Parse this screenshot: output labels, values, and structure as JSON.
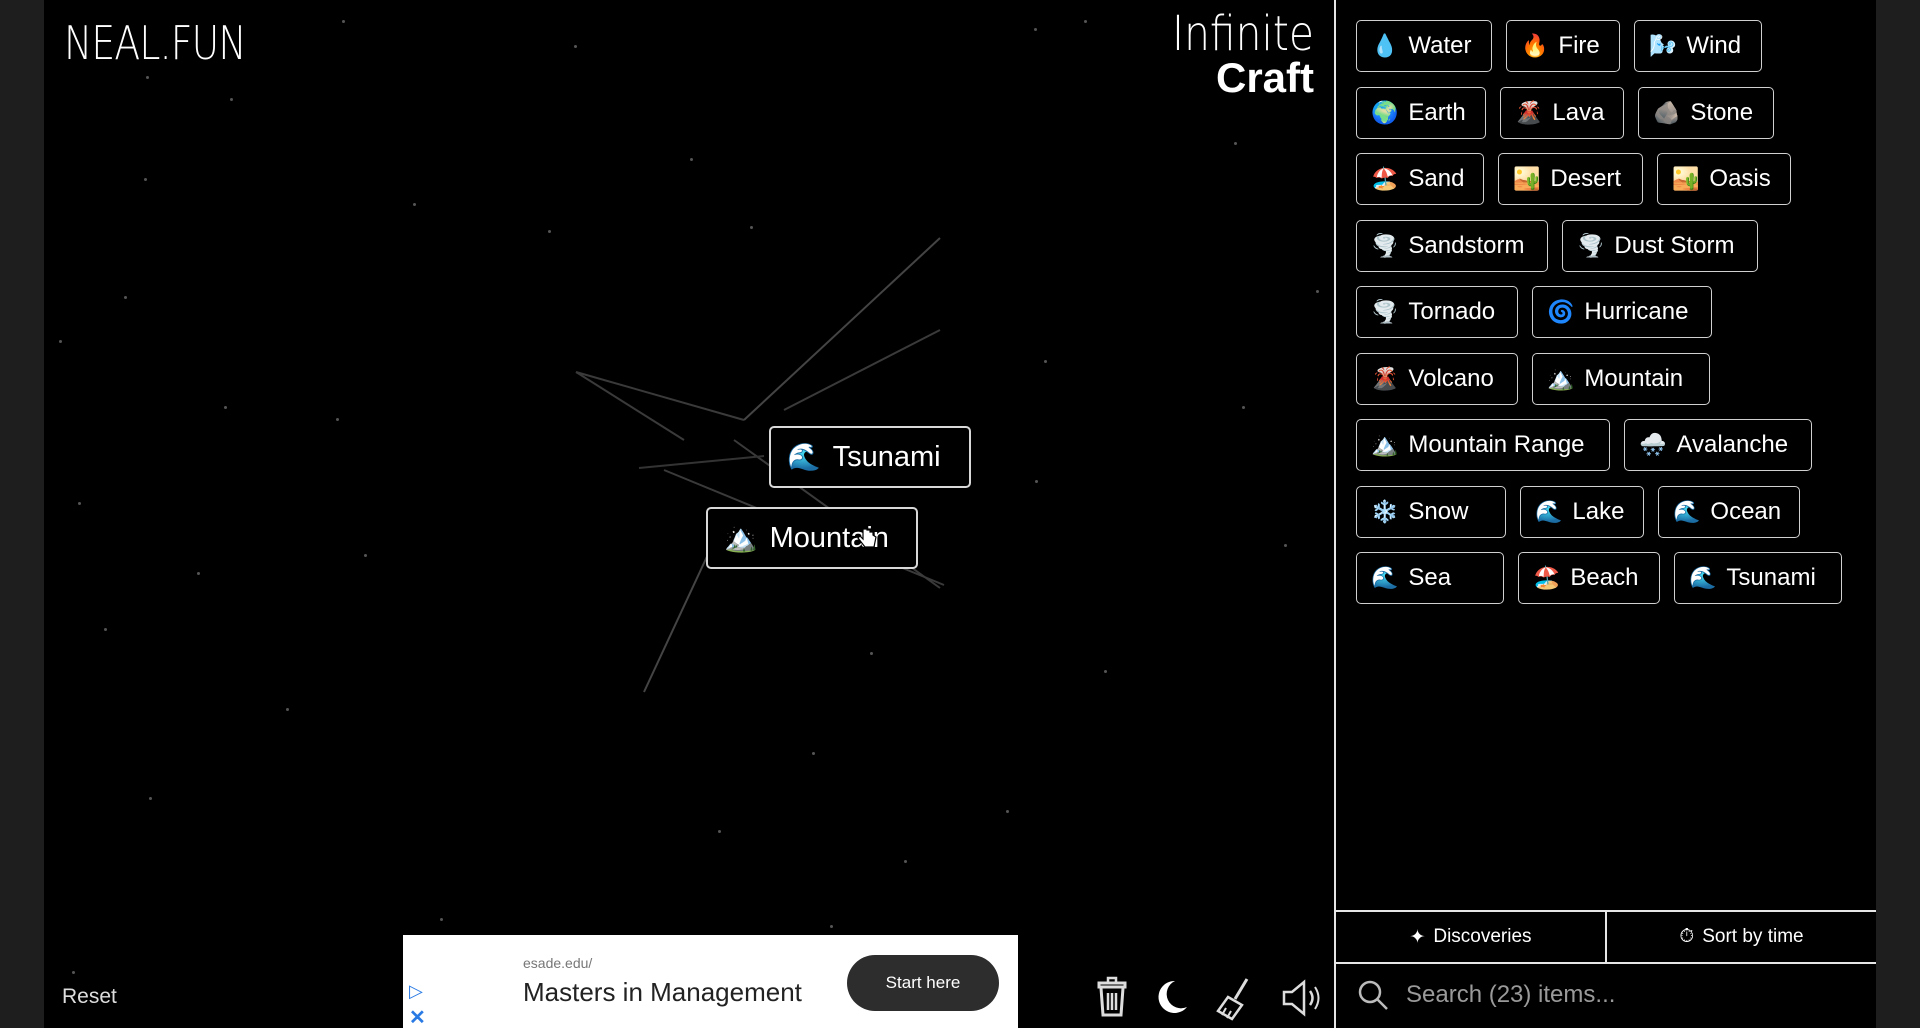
{
  "brand": {
    "left": "NEAL.FUN",
    "right_line1": "Infinite",
    "right_line2": "Craft"
  },
  "canvas": {
    "chips": [
      {
        "emoji": "🌊",
        "label": "Tsunami"
      },
      {
        "emoji": "🏔️",
        "label": "Mountain"
      }
    ],
    "reset_label": "Reset"
  },
  "ad": {
    "url": "esade.edu/",
    "title": "Masters in Management",
    "cta": "Start here",
    "play_glyph": "▷",
    "close_glyph": "✕"
  },
  "toolbar": {
    "icons": [
      "trash-icon",
      "moon-icon",
      "broom-icon",
      "speaker-icon"
    ]
  },
  "sidebar": {
    "items": [
      {
        "emoji": "💧",
        "label": "Water"
      },
      {
        "emoji": "🔥",
        "label": "Fire"
      },
      {
        "emoji": "🌬️",
        "label": "Wind"
      },
      {
        "emoji": "🌍",
        "label": "Earth"
      },
      {
        "emoji": "🌋",
        "label": "Lava"
      },
      {
        "emoji": "🪨",
        "label": "Stone"
      },
      {
        "emoji": "🏖️",
        "label": "Sand"
      },
      {
        "emoji": "🏜️",
        "label": "Desert"
      },
      {
        "emoji": "🏜️",
        "label": "Oasis"
      },
      {
        "emoji": "🌪️",
        "label": "Sandstorm"
      },
      {
        "emoji": "🌪️",
        "label": "Dust Storm"
      },
      {
        "emoji": "🌪️",
        "label": "Tornado"
      },
      {
        "emoji": "🌀",
        "label": "Hurricane"
      },
      {
        "emoji": "🌋",
        "label": "Volcano"
      },
      {
        "emoji": "🏔️",
        "label": "Mountain"
      },
      {
        "emoji": "🏔️",
        "label": "Mountain Range"
      },
      {
        "emoji": "🌨️",
        "label": "Avalanche"
      },
      {
        "emoji": "❄️",
        "label": "Snow"
      },
      {
        "emoji": "🌊",
        "label": "Lake"
      },
      {
        "emoji": "🌊",
        "label": "Ocean"
      },
      {
        "emoji": "🌊",
        "label": "Sea"
      },
      {
        "emoji": "🏖️",
        "label": "Beach"
      },
      {
        "emoji": "🌊",
        "label": "Tsunami"
      }
    ],
    "discoveries_label": "Discoveries",
    "discoveries_glyph": "✦",
    "sort_label": "Sort by time",
    "sort_glyph": "⏱",
    "search_placeholder": "Search (23) items..."
  }
}
